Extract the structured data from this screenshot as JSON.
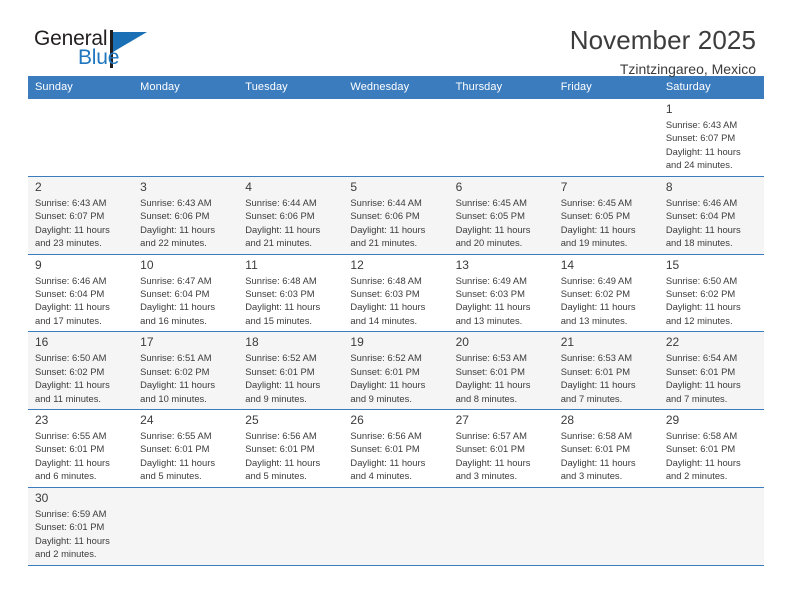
{
  "logo": {
    "text_top": "General",
    "text_bottom": "Blue",
    "icon": "flag-triangle-icon",
    "color_blue": "#2077c0",
    "color_dark": "#231f20"
  },
  "header": {
    "month_title": "November 2025",
    "location": "Tzintzingareo, Mexico"
  },
  "calendar": {
    "header_background": "#3b7cbf",
    "weekdays": [
      "Sunday",
      "Monday",
      "Tuesday",
      "Wednesday",
      "Thursday",
      "Friday",
      "Saturday"
    ],
    "weeks": [
      [
        {
          "day": "",
          "lines": []
        },
        {
          "day": "",
          "lines": []
        },
        {
          "day": "",
          "lines": []
        },
        {
          "day": "",
          "lines": []
        },
        {
          "day": "",
          "lines": []
        },
        {
          "day": "",
          "lines": []
        },
        {
          "day": "1",
          "lines": [
            "Sunrise: 6:43 AM",
            "Sunset: 6:07 PM",
            "Daylight: 11 hours",
            "and 24 minutes."
          ]
        }
      ],
      [
        {
          "day": "2",
          "lines": [
            "Sunrise: 6:43 AM",
            "Sunset: 6:07 PM",
            "Daylight: 11 hours",
            "and 23 minutes."
          ]
        },
        {
          "day": "3",
          "lines": [
            "Sunrise: 6:43 AM",
            "Sunset: 6:06 PM",
            "Daylight: 11 hours",
            "and 22 minutes."
          ]
        },
        {
          "day": "4",
          "lines": [
            "Sunrise: 6:44 AM",
            "Sunset: 6:06 PM",
            "Daylight: 11 hours",
            "and 21 minutes."
          ]
        },
        {
          "day": "5",
          "lines": [
            "Sunrise: 6:44 AM",
            "Sunset: 6:06 PM",
            "Daylight: 11 hours",
            "and 21 minutes."
          ]
        },
        {
          "day": "6",
          "lines": [
            "Sunrise: 6:45 AM",
            "Sunset: 6:05 PM",
            "Daylight: 11 hours",
            "and 20 minutes."
          ]
        },
        {
          "day": "7",
          "lines": [
            "Sunrise: 6:45 AM",
            "Sunset: 6:05 PM",
            "Daylight: 11 hours",
            "and 19 minutes."
          ]
        },
        {
          "day": "8",
          "lines": [
            "Sunrise: 6:46 AM",
            "Sunset: 6:04 PM",
            "Daylight: 11 hours",
            "and 18 minutes."
          ]
        }
      ],
      [
        {
          "day": "9",
          "lines": [
            "Sunrise: 6:46 AM",
            "Sunset: 6:04 PM",
            "Daylight: 11 hours",
            "and 17 minutes."
          ]
        },
        {
          "day": "10",
          "lines": [
            "Sunrise: 6:47 AM",
            "Sunset: 6:04 PM",
            "Daylight: 11 hours",
            "and 16 minutes."
          ]
        },
        {
          "day": "11",
          "lines": [
            "Sunrise: 6:48 AM",
            "Sunset: 6:03 PM",
            "Daylight: 11 hours",
            "and 15 minutes."
          ]
        },
        {
          "day": "12",
          "lines": [
            "Sunrise: 6:48 AM",
            "Sunset: 6:03 PM",
            "Daylight: 11 hours",
            "and 14 minutes."
          ]
        },
        {
          "day": "13",
          "lines": [
            "Sunrise: 6:49 AM",
            "Sunset: 6:03 PM",
            "Daylight: 11 hours",
            "and 13 minutes."
          ]
        },
        {
          "day": "14",
          "lines": [
            "Sunrise: 6:49 AM",
            "Sunset: 6:02 PM",
            "Daylight: 11 hours",
            "and 13 minutes."
          ]
        },
        {
          "day": "15",
          "lines": [
            "Sunrise: 6:50 AM",
            "Sunset: 6:02 PM",
            "Daylight: 11 hours",
            "and 12 minutes."
          ]
        }
      ],
      [
        {
          "day": "16",
          "lines": [
            "Sunrise: 6:50 AM",
            "Sunset: 6:02 PM",
            "Daylight: 11 hours",
            "and 11 minutes."
          ]
        },
        {
          "day": "17",
          "lines": [
            "Sunrise: 6:51 AM",
            "Sunset: 6:02 PM",
            "Daylight: 11 hours",
            "and 10 minutes."
          ]
        },
        {
          "day": "18",
          "lines": [
            "Sunrise: 6:52 AM",
            "Sunset: 6:01 PM",
            "Daylight: 11 hours",
            "and 9 minutes."
          ]
        },
        {
          "day": "19",
          "lines": [
            "Sunrise: 6:52 AM",
            "Sunset: 6:01 PM",
            "Daylight: 11 hours",
            "and 9 minutes."
          ]
        },
        {
          "day": "20",
          "lines": [
            "Sunrise: 6:53 AM",
            "Sunset: 6:01 PM",
            "Daylight: 11 hours",
            "and 8 minutes."
          ]
        },
        {
          "day": "21",
          "lines": [
            "Sunrise: 6:53 AM",
            "Sunset: 6:01 PM",
            "Daylight: 11 hours",
            "and 7 minutes."
          ]
        },
        {
          "day": "22",
          "lines": [
            "Sunrise: 6:54 AM",
            "Sunset: 6:01 PM",
            "Daylight: 11 hours",
            "and 7 minutes."
          ]
        }
      ],
      [
        {
          "day": "23",
          "lines": [
            "Sunrise: 6:55 AM",
            "Sunset: 6:01 PM",
            "Daylight: 11 hours",
            "and 6 minutes."
          ]
        },
        {
          "day": "24",
          "lines": [
            "Sunrise: 6:55 AM",
            "Sunset: 6:01 PM",
            "Daylight: 11 hours",
            "and 5 minutes."
          ]
        },
        {
          "day": "25",
          "lines": [
            "Sunrise: 6:56 AM",
            "Sunset: 6:01 PM",
            "Daylight: 11 hours",
            "and 5 minutes."
          ]
        },
        {
          "day": "26",
          "lines": [
            "Sunrise: 6:56 AM",
            "Sunset: 6:01 PM",
            "Daylight: 11 hours",
            "and 4 minutes."
          ]
        },
        {
          "day": "27",
          "lines": [
            "Sunrise: 6:57 AM",
            "Sunset: 6:01 PM",
            "Daylight: 11 hours",
            "and 3 minutes."
          ]
        },
        {
          "day": "28",
          "lines": [
            "Sunrise: 6:58 AM",
            "Sunset: 6:01 PM",
            "Daylight: 11 hours",
            "and 3 minutes."
          ]
        },
        {
          "day": "29",
          "lines": [
            "Sunrise: 6:58 AM",
            "Sunset: 6:01 PM",
            "Daylight: 11 hours",
            "and 2 minutes."
          ]
        }
      ],
      [
        {
          "day": "30",
          "lines": [
            "Sunrise: 6:59 AM",
            "Sunset: 6:01 PM",
            "Daylight: 11 hours",
            "and 2 minutes."
          ]
        },
        {
          "day": "",
          "lines": []
        },
        {
          "day": "",
          "lines": []
        },
        {
          "day": "",
          "lines": []
        },
        {
          "day": "",
          "lines": []
        },
        {
          "day": "",
          "lines": []
        },
        {
          "day": "",
          "lines": []
        }
      ]
    ]
  }
}
